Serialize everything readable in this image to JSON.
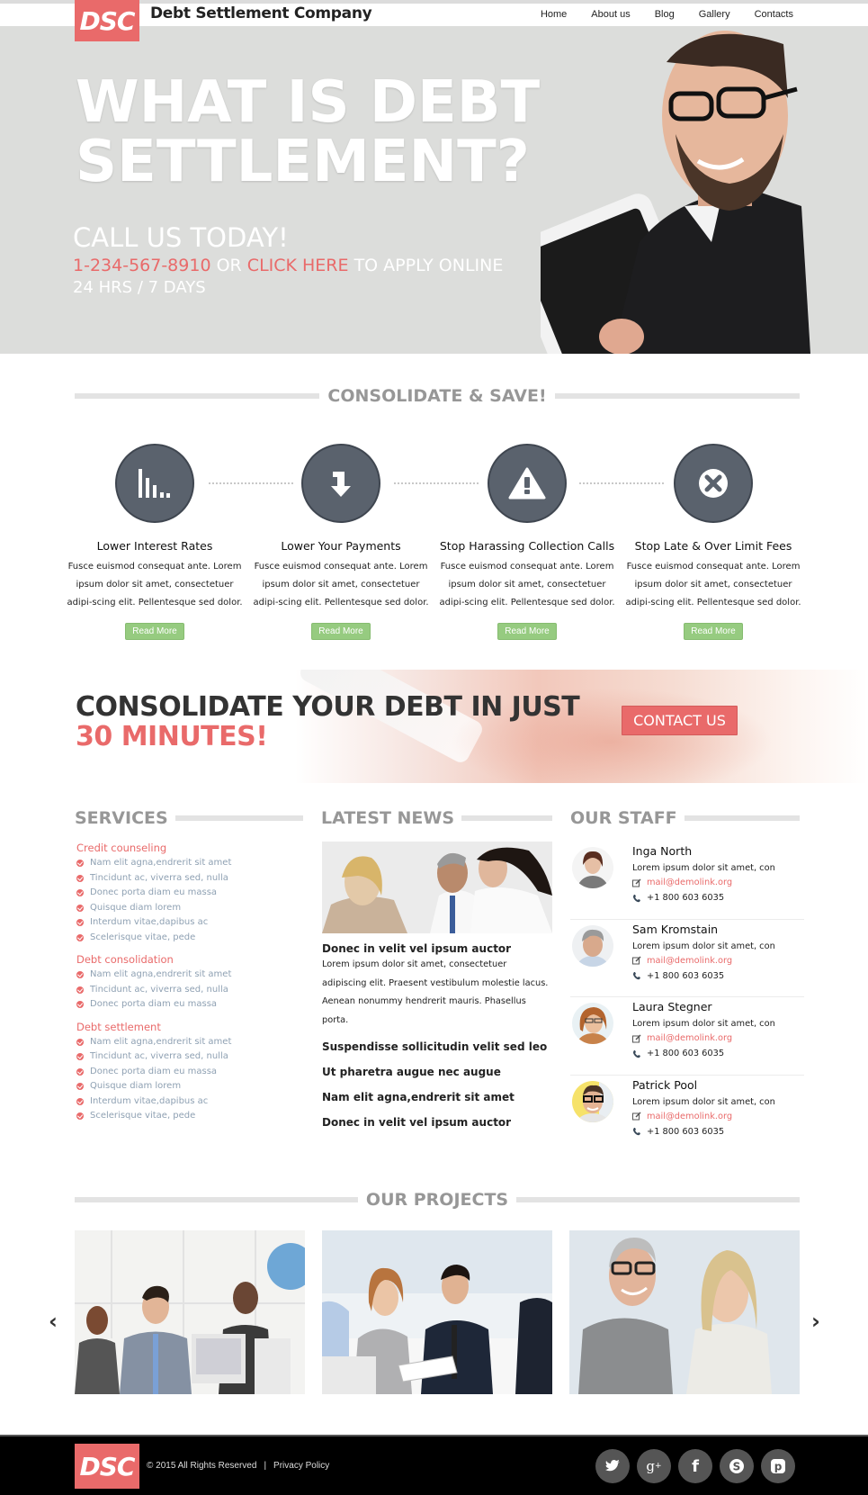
{
  "header": {
    "logo_text": "DSC",
    "company_name": "Debt Settlement Company",
    "nav": [
      "Home",
      "About us",
      "Blog",
      "Gallery",
      "Contacts"
    ]
  },
  "hero": {
    "title_line1": "WHAT IS DEBT",
    "title_line2": "SETTLEMENT?",
    "call": "CALL US TODAY!",
    "phone": "1-234-567-8910",
    "or": " OR ",
    "click_here": "CLICK HERE",
    "apply": " TO APPLY ONLINE",
    "hours": "24 HRS / 7 DAYS"
  },
  "consolidate": {
    "title": "CONSOLIDATE & SAVE!",
    "features": [
      {
        "icon": "bar-chart-icon",
        "title": "Lower Interest Rates",
        "text": "Fusce euismod consequat ante. Lorem ipsum dolor sit amet, consectetuer adipi-scing elit. Pellentesque sed dolor.",
        "button": "Read More"
      },
      {
        "icon": "arrow-down-icon",
        "title": "Lower Your Payments",
        "text": "Fusce euismod consequat ante. Lorem ipsum dolor sit amet, consectetuer adipi-scing elit. Pellentesque sed dolor.",
        "button": "Read More"
      },
      {
        "icon": "warning-icon",
        "title": "Stop Harassing Collection Calls",
        "text": "Fusce euismod consequat ante. Lorem ipsum dolor sit amet, consectetuer adipi-scing elit. Pellentesque sed dolor.",
        "button": "Read More"
      },
      {
        "icon": "close-circle-icon",
        "title": "Stop Late & Over Limit Fees",
        "text": "Fusce euismod consequat ante. Lorem ipsum dolor sit amet, consectetuer adipi-scing elit. Pellentesque sed dolor.",
        "button": "Read More"
      }
    ]
  },
  "banner": {
    "line1": "CONSOLIDATE YOUR DEBT IN JUST",
    "line2": "30 MINUTES!",
    "button": "CONTACT US"
  },
  "services": {
    "title": "SERVICES",
    "groups": [
      {
        "title": "Credit counseling",
        "items": [
          "Nam elit agna,endrerit sit amet",
          "Tincidunt ac, viverra sed, nulla",
          "Donec porta diam eu massa",
          "Quisque diam lorem",
          "Interdum vitae,dapibus ac",
          "Scelerisque vitae, pede"
        ]
      },
      {
        "title": "Debt consolidation",
        "items": [
          "Nam elit agna,endrerit sit amet",
          "Tincidunt ac, viverra sed, nulla",
          "Donec porta diam eu massa"
        ]
      },
      {
        "title": "Debt settlement",
        "items": [
          "Nam elit agna,endrerit sit amet",
          "Tincidunt ac, viverra sed, nulla",
          "Donec porta diam eu massa",
          "Quisque diam lorem",
          "Interdum vitae,dapibus ac",
          "Scelerisque vitae, pede"
        ]
      }
    ]
  },
  "news": {
    "title": "LATEST NEWS",
    "headline": "Donec in velit vel ipsum auctor",
    "body": "Lorem ipsum dolor sit amet, consectetuer adipiscing elit. Praesent vestibulum molestie lacus. Aenean nonummy hendrerit mauris. Phasellus porta.",
    "links": [
      "Suspendisse sollicitudin velit sed leo",
      "Ut pharetra augue nec augue",
      "Nam elit agna,endrerit sit amet",
      "Donec in velit vel ipsum auctor"
    ]
  },
  "staff": {
    "title": "OUR STAFF",
    "members": [
      {
        "name": "Inga North",
        "desc": "Lorem ipsum dolor sit amet, con",
        "email": "mail@demolink.org",
        "phone": "+1 800 603 6035"
      },
      {
        "name": "Sam Kromstain",
        "desc": "Lorem ipsum dolor sit amet, con",
        "email": "mail@demolink.org",
        "phone": "+1 800 603 6035"
      },
      {
        "name": "Laura Stegner",
        "desc": "Lorem ipsum dolor sit amet, con",
        "email": "mail@demolink.org",
        "phone": "+1 800 603 6035"
      },
      {
        "name": "Patrick Pool",
        "desc": "Lorem ipsum dolor sit amet, con",
        "email": "mail@demolink.org",
        "phone": "+1 800 603 6035"
      }
    ]
  },
  "projects": {
    "title": "OUR PROJECTS",
    "prev": "‹",
    "next": "›"
  },
  "footer": {
    "logo_text": "DSC",
    "copyright": "© 2015 All Rights Reserved",
    "separator": "|",
    "privacy": "Privacy Policy",
    "socials": [
      {
        "name": "twitter",
        "glyph": "t"
      },
      {
        "name": "google-plus",
        "glyph": "g+"
      },
      {
        "name": "facebook",
        "glyph": "f"
      },
      {
        "name": "skype",
        "glyph": "S"
      },
      {
        "name": "pinterest",
        "glyph": "p"
      }
    ]
  },
  "colors": {
    "accent": "#e96a6a",
    "button_green": "#96cb80",
    "icon_circle": "#5a626d",
    "section_title": "#979797"
  }
}
